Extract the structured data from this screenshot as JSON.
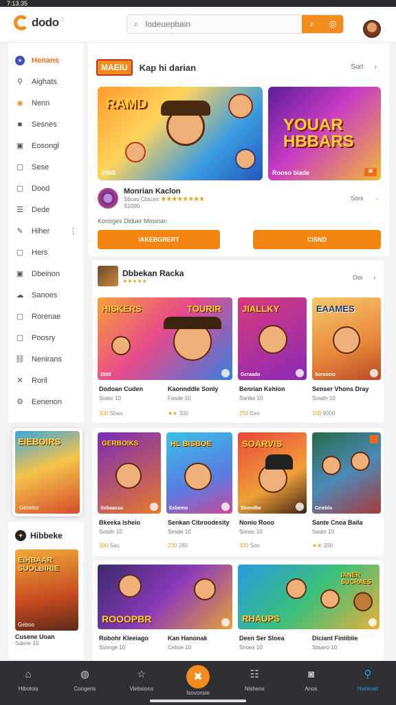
{
  "status": {
    "time": "7:13.35"
  },
  "header": {
    "logo": "dodo",
    "search_placeholder": "Iodeuepbain"
  },
  "sidebar": {
    "items": [
      {
        "label": "Henans",
        "icon": "circle-icon",
        "active": true
      },
      {
        "label": "Aighats",
        "icon": "pin-icon"
      },
      {
        "label": "Nenn",
        "icon": "dot-icon"
      },
      {
        "label": "Sesnes",
        "icon": "square-icon"
      },
      {
        "label": "Eosongl",
        "icon": "square-icon"
      },
      {
        "label": "Sese",
        "icon": "window-icon"
      },
      {
        "label": "Dood",
        "icon": "window-icon"
      },
      {
        "label": "Dede",
        "icon": "list-icon"
      },
      {
        "label": "Hiher",
        "icon": "edit-icon"
      },
      {
        "label": "Hers",
        "icon": "window-icon"
      },
      {
        "label": "Dbeinon",
        "icon": "square-icon"
      },
      {
        "label": "Sanoes",
        "icon": "cloud-icon"
      },
      {
        "label": "Rorenae",
        "icon": "window-icon"
      },
      {
        "label": "Poosry",
        "icon": "window-icon"
      },
      {
        "label": "Nenirans",
        "icon": "link-icon"
      },
      {
        "label": "Roril",
        "icon": "cross-icon"
      },
      {
        "label": "Eenenon",
        "icon": "gear-icon"
      }
    ],
    "promo": {
      "title": "EIEBOIRS",
      "label": "Gesebo"
    },
    "widget": {
      "title": "Hibbeke",
      "image_title": "EIHBAAR SUOLBIRIE",
      "image_label": "Geboo",
      "name": "Cusene Uoan",
      "sub": "Sdene 10"
    }
  },
  "featured_section": {
    "badge": "MAEIU",
    "title": "Kap hi darian",
    "sort_label": "Sort",
    "banner1": {
      "title": "RAMD",
      "label": "2000"
    },
    "banner2": {
      "title": "YOUAR HBBARS",
      "label": "Rooso biade"
    },
    "featured_game": {
      "name": "Monrian Kaclon",
      "meta_line1": "Sbcas Cbsces",
      "meta_line2": "S1000",
      "stars": "★★★★★★★★",
      "right_label": "Sors"
    },
    "description": "Konoges Diduer Mosinan",
    "button1": "IAKEBGRERT",
    "button2": "CISND"
  },
  "section2": {
    "title": "Dbbekan Racka",
    "stars": "★★★★★",
    "right_label": "Ooi",
    "games": [
      {
        "name": "Dodoan Cuden",
        "sub": "Soasr 10",
        "rating": "300",
        "rating_label": "Sbao",
        "tile_title": "HISKERS",
        "tile_label": "2000"
      },
      {
        "name": "Kaonnddle Sonly",
        "sub": "Fasde 10",
        "rating": "★★",
        "rating_label": "300",
        "tile_title": "TOURIR",
        "tile_label": "Grbrine"
      },
      {
        "name": "Benrian Kehlon",
        "sub": "Sanba 10",
        "rating": "250",
        "rating_label": "Eeo",
        "tile_title": "JIALLKY",
        "tile_label": "Gcraado"
      },
      {
        "name": "Senser Vhons Dray",
        "sub": "Sosdn 10",
        "rating": "100",
        "rating_label": "9000",
        "tile_title": "EAAMES",
        "tile_label": "Sorsocio"
      }
    ]
  },
  "section3": {
    "games": [
      {
        "name": "Bkeeka Isheio",
        "sub": "Sosdn 10",
        "rating": "390",
        "rating_label": "Sao",
        "tile_title": "GERBOIKS",
        "tile_label": "Sobaasso"
      },
      {
        "name": "Senkan Cibroodesity",
        "sub": "Sesde 10",
        "rating": "230",
        "rating_label": "280",
        "tile_title": "HL BISBOE",
        "tile_label": "Esbemo"
      },
      {
        "name": "Nonio Rooo",
        "sub": "Sonec 10",
        "rating": "320",
        "rating_label": "Soo",
        "tile_title": "SOARVIS",
        "tile_label": "Sbondbe"
      },
      {
        "name": "Sante Cnoa Baila",
        "sub": "Sasbr 10",
        "rating": "★★",
        "rating_label": "200",
        "tile_title": "",
        "tile_label": "Ceieblo"
      }
    ]
  },
  "section4": {
    "games": [
      {
        "name": "Robohr Kleeiago",
        "sub": "Ssnnge 10",
        "tile_title": "ROOOPBR"
      },
      {
        "name": "Kan Hanonak",
        "sub": "Cebse 10",
        "tile_title": ""
      },
      {
        "name": "Deen Ser Sloea",
        "sub": "Snoex 10",
        "tile_title": "RHAUPS"
      },
      {
        "name": "Diciant Finiibiie",
        "sub": "Sbiaeo 10",
        "tile_title": "IANER SUCRAES"
      }
    ]
  },
  "bottom_nav": [
    {
      "label": "Hibotols",
      "icon": "home-icon"
    },
    {
      "label": "Congens",
      "icon": "controller-icon"
    },
    {
      "label": "Viebsions",
      "icon": "star-icon"
    },
    {
      "label": "Isovonsie",
      "icon": "puzzle-icon",
      "center": true
    },
    {
      "label": "Nishens",
      "icon": "list-icon"
    },
    {
      "label": "Anos",
      "icon": "camera-icon"
    },
    {
      "label": "Hanimet",
      "icon": "user-icon",
      "active": true
    }
  ],
  "colors": {
    "accent": "#f28c1c",
    "nav_bg": "#2e3034",
    "active_blue": "#2d9cdb"
  }
}
